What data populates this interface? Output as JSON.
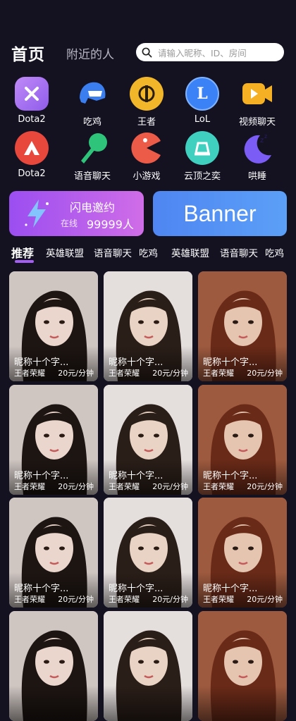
{
  "header": {
    "tab_home": "首页",
    "tab_nearby": "附近的人",
    "search_placeholder": "请输入昵称、ID、房间"
  },
  "categories": [
    {
      "label": "Dota2",
      "icon": "dota2-icon",
      "color": "#a46ef0"
    },
    {
      "label": "吃鸡",
      "icon": "helmet-icon",
      "color": "#3b7ef0"
    },
    {
      "label": "王者",
      "icon": "king-icon",
      "color": "#f2b62a"
    },
    {
      "label": "LoL",
      "icon": "lol-icon",
      "color": "#3b82f6"
    },
    {
      "label": "视频聊天",
      "icon": "video-chat-icon",
      "color": "#f5b023"
    },
    {
      "label": "Dota2",
      "icon": "apex-icon",
      "color": "#e8473c"
    },
    {
      "label": "语音聊天",
      "icon": "microphone-icon",
      "color": "#2ec47a"
    },
    {
      "label": "小游戏",
      "icon": "pacman-icon",
      "color": "#ec5b47"
    },
    {
      "label": "云顶之奕",
      "icon": "cloud-top-icon",
      "color": "#3fd0c0"
    },
    {
      "label": "哄睡",
      "icon": "moon-sleep-icon",
      "color": "#7b5cf5"
    }
  ],
  "banners": {
    "flash": {
      "title": "闪电邀约",
      "online_label": "在线",
      "online_count": "99999人"
    },
    "banner": "Banner"
  },
  "tabs": [
    "推荐",
    "英雄联盟",
    "语音聊天",
    "吃鸡",
    "英雄联盟",
    "语音聊天",
    "吃鸡"
  ],
  "cards": [
    {
      "name": "昵称十个字...",
      "game": "王者荣耀",
      "price": "20元/分钟"
    },
    {
      "name": "昵称十个字...",
      "game": "王者荣耀",
      "price": "20元/分钟"
    },
    {
      "name": "昵称十个字...",
      "game": "王者荣耀",
      "price": "20元/分钟"
    },
    {
      "name": "昵称十个字...",
      "game": "王者荣耀",
      "price": "20元/分钟"
    },
    {
      "name": "昵称十个字...",
      "game": "王者荣耀",
      "price": "20元/分钟"
    },
    {
      "name": "昵称十个字...",
      "game": "王者荣耀",
      "price": "20元/分钟"
    },
    {
      "name": "昵称十个字...",
      "game": "王者荣耀",
      "price": "20元/分钟"
    },
    {
      "name": "昵称十个字...",
      "game": "王者荣耀",
      "price": "20元/分钟"
    },
    {
      "name": "昵称十个字...",
      "game": "王者荣耀",
      "price": "20元/分钟"
    },
    {
      "name": "",
      "game": "",
      "price": ""
    },
    {
      "name": "",
      "game": "",
      "price": ""
    },
    {
      "name": "",
      "game": "",
      "price": ""
    }
  ],
  "colors": {
    "background": "#141121",
    "accent": "#a45ef5",
    "banner_purple": "#b05df0",
    "banner_blue": "#4f86f2"
  }
}
